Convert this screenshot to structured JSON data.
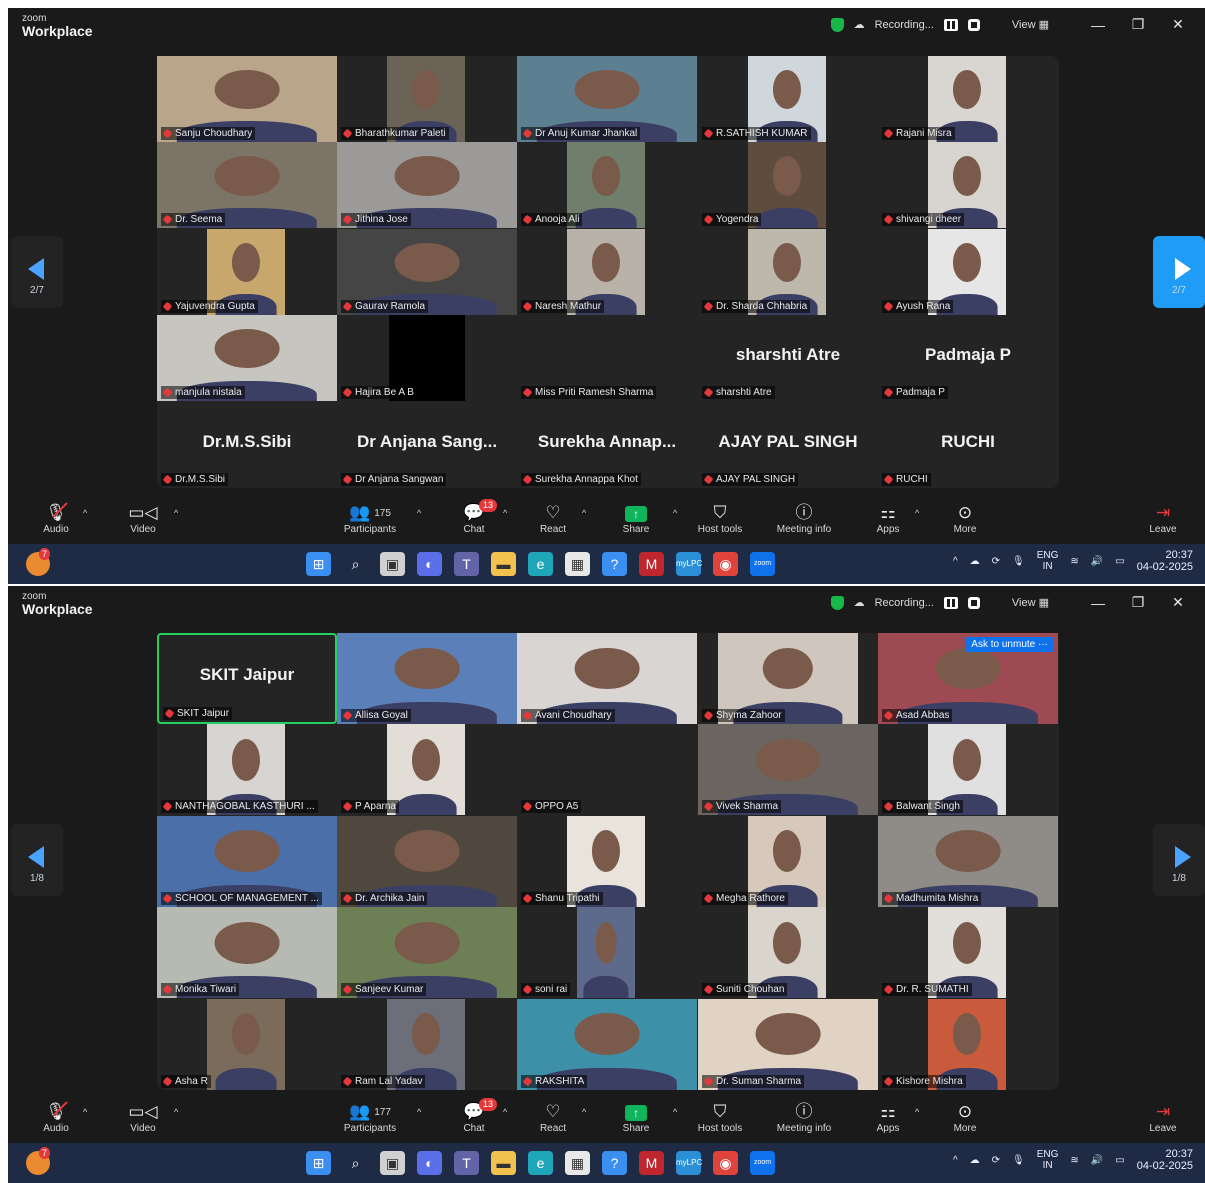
{
  "app": {
    "brand_small": "zoom",
    "brand_name": "Workplace"
  },
  "titlebar": {
    "recording_label": "Recording...",
    "view_label": "View"
  },
  "toolbar": {
    "audio": "Audio",
    "video": "Video",
    "participants": "Participants",
    "chat": "Chat",
    "chat_badge": "13",
    "react": "React",
    "share": "Share",
    "host_tools": "Host tools",
    "meeting_info": "Meeting info",
    "apps": "Apps",
    "more": "More",
    "leave": "Leave"
  },
  "taskbar": {
    "notif_badge": "7",
    "lang_top": "ENG",
    "lang_bottom": "IN",
    "time": "20:37",
    "date": "04-02-2025"
  },
  "shot1": {
    "participant_count": "175",
    "page_indicator": "2/7",
    "tiles": [
      {
        "name": "Sanju Choudhary",
        "type": "video"
      },
      {
        "name": "Bharathkumar Paleti",
        "type": "video"
      },
      {
        "name": "Dr Anuj Kumar Jhankal",
        "type": "video"
      },
      {
        "name": "R.SATHISH KUMAR",
        "type": "video"
      },
      {
        "name": "Rajani Misra",
        "type": "video"
      },
      {
        "name": "Dr. Seema",
        "type": "video"
      },
      {
        "name": "Jithina Jose",
        "type": "video"
      },
      {
        "name": "Anooja Ali",
        "type": "video"
      },
      {
        "name": "Yogendra",
        "type": "video"
      },
      {
        "name": "shivangi dheer",
        "type": "video"
      },
      {
        "name": "Yajuvendra Gupta",
        "type": "video"
      },
      {
        "name": "Gaurav Ramola",
        "type": "video"
      },
      {
        "name": "Naresh Mathur",
        "type": "video"
      },
      {
        "name": "Dr. Sharda Chhabria",
        "type": "video"
      },
      {
        "name": "Ayush Rana",
        "type": "video"
      },
      {
        "name": "manjula nistala",
        "type": "video"
      },
      {
        "name": "Hajira Be A B",
        "type": "black"
      },
      {
        "name": "Miss Priti Ramesh Sharma",
        "type": "empty"
      },
      {
        "name": "sharshti Atre",
        "type": "text",
        "big": "sharshti Atre"
      },
      {
        "name": "Padmaja P",
        "type": "text",
        "big": "Padmaja P"
      },
      {
        "name": "Dr.M.S.Sibi",
        "type": "text",
        "big": "Dr.M.S.Sibi"
      },
      {
        "name": "Dr Anjana Sangwan",
        "type": "text",
        "big": "Dr Anjana Sang..."
      },
      {
        "name": "Surekha Annappa Khot",
        "type": "text",
        "big": "Surekha Annap..."
      },
      {
        "name": "AJAY PAL SINGH",
        "type": "text",
        "big": "AJAY PAL SINGH"
      },
      {
        "name": "RUCHI",
        "type": "text",
        "big": "RUCHI"
      }
    ]
  },
  "shot2": {
    "participant_count": "177",
    "page_indicator": "1/8",
    "ask_to_unmute": "Ask to unmute",
    "tiles": [
      {
        "name": "SKIT Jaipur",
        "type": "text",
        "big": "SKIT Jaipur",
        "highlight": true
      },
      {
        "name": "Allisa Goyal",
        "type": "video"
      },
      {
        "name": "Avani Choudhary",
        "type": "video"
      },
      {
        "name": "Shyma Zahoor",
        "type": "video"
      },
      {
        "name": "Asad Abbas",
        "type": "video",
        "ask": true
      },
      {
        "name": "NANTHAGOBAL KASTHURI ...",
        "type": "video"
      },
      {
        "name": "P Aparna",
        "type": "video"
      },
      {
        "name": "OPPO A5",
        "type": "empty"
      },
      {
        "name": "Vivek Sharma",
        "type": "video"
      },
      {
        "name": "Balwant Singh",
        "type": "video"
      },
      {
        "name": "SCHOOL OF MANAGEMENT ...",
        "type": "video"
      },
      {
        "name": "Dr. Archika Jain",
        "type": "video"
      },
      {
        "name": "Shanu Tripathi",
        "type": "video"
      },
      {
        "name": "Megha Rathore",
        "type": "video"
      },
      {
        "name": "Madhumita Mishra",
        "type": "video"
      },
      {
        "name": "Monika Tiwari",
        "type": "video"
      },
      {
        "name": "Sanjeev Kumar",
        "type": "video"
      },
      {
        "name": "soni rai",
        "type": "video"
      },
      {
        "name": "Suniti Chouhan",
        "type": "video"
      },
      {
        "name": "Dr. R. SUMATHI",
        "type": "video"
      },
      {
        "name": "Asha R",
        "type": "video"
      },
      {
        "name": "Ram Lal Yadav",
        "type": "video"
      },
      {
        "name": "RAKSHITA",
        "type": "video"
      },
      {
        "name": "Dr. Suman Sharma",
        "type": "video"
      },
      {
        "name": "Kishore Mishra",
        "type": "video"
      }
    ]
  }
}
